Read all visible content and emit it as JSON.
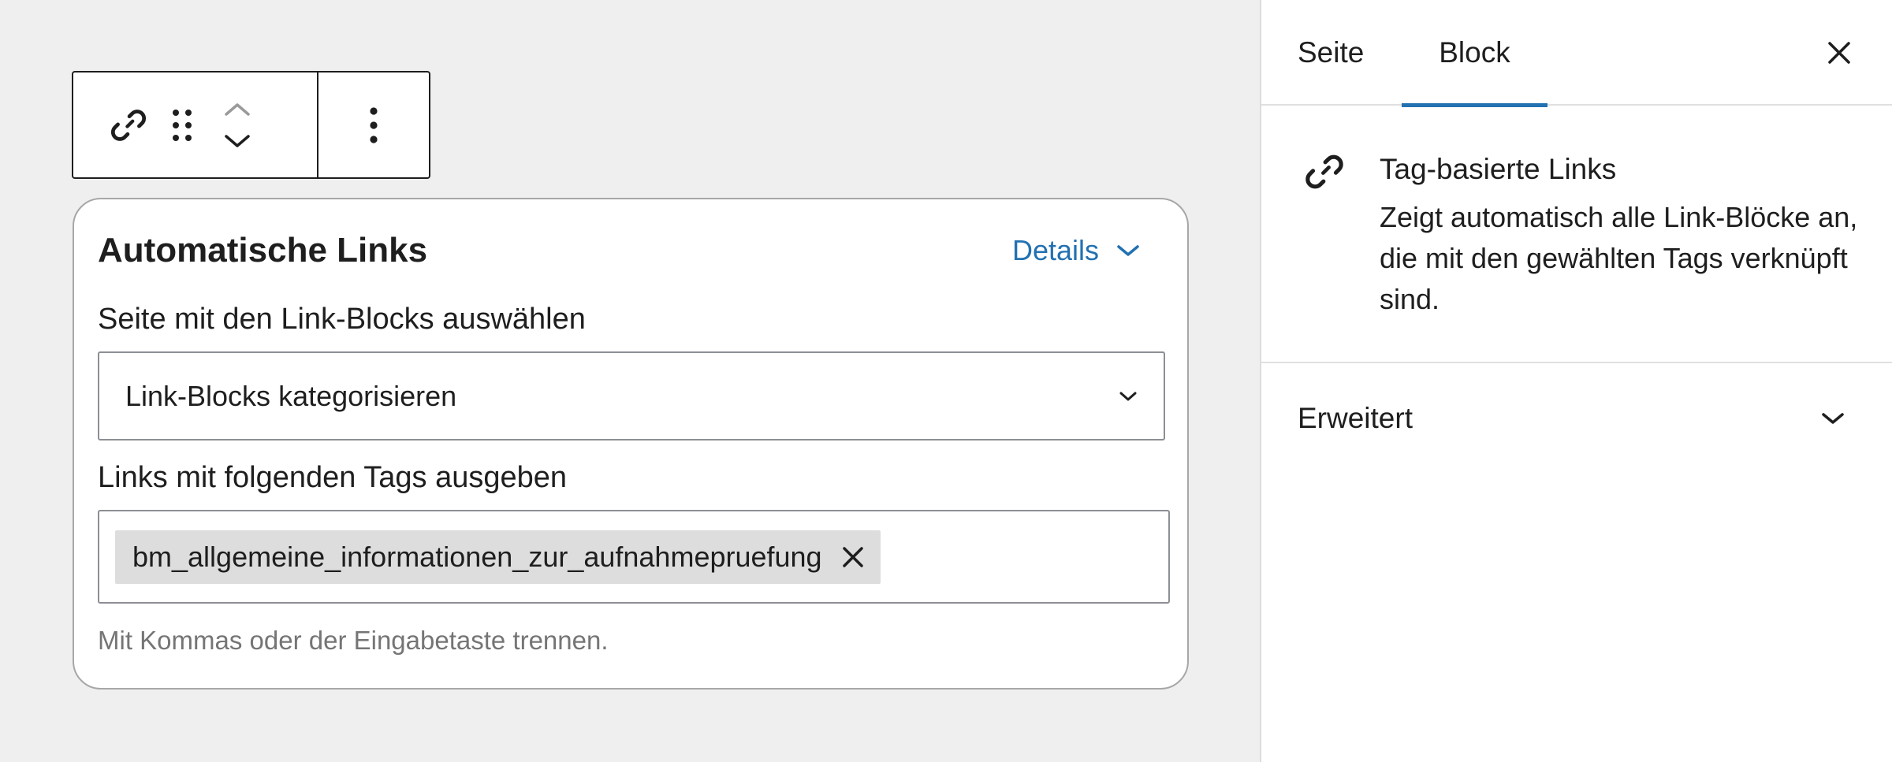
{
  "toolbar": {
    "link_icon": "link-icon",
    "drag_icon": "drag-handle-icon",
    "move_up_icon": "chevron-up-icon",
    "move_down_icon": "chevron-down-icon",
    "more_icon": "more-vertical-icon"
  },
  "block": {
    "title": "Automatische Links",
    "details_label": "Details",
    "page_select_label": "Seite mit den Link-Blocks auswählen",
    "page_select_value": "Link-Blocks kategorisieren",
    "tags_label": "Links mit folgenden Tags ausgeben",
    "tags": [
      "bm_allgemeine_informationen_zur_aufnahmepruefung"
    ],
    "help_text": "Mit Kommas oder der Eingabetaste trennen."
  },
  "sidebar": {
    "tabs": [
      {
        "label": "Seite",
        "active": false
      },
      {
        "label": "Block",
        "active": true
      }
    ],
    "block_info": {
      "title": "Tag-basierte Links",
      "description": "Zeigt automatisch alle Link-Blöcke an, die mit den gewählten Tags verknüpft sind."
    },
    "advanced_panel": {
      "label": "Erweitert",
      "expanded": false
    }
  },
  "colors": {
    "accent": "#2271b1",
    "canvas_bg": "#efefef",
    "token_bg": "#dddddd",
    "help_text": "#757575"
  }
}
